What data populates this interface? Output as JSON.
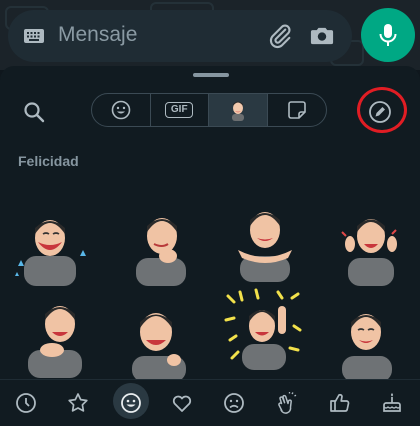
{
  "composer": {
    "placeholder": "Mensaje",
    "keyboard_icon": "keyboard-icon",
    "attach_icon": "paperclip-icon",
    "camera_icon": "camera-icon",
    "mic_icon": "microphone-icon",
    "accent": "#00a884"
  },
  "panel": {
    "search_icon": "search-icon",
    "tabs": [
      {
        "id": "emoji",
        "icon": "smiley-icon",
        "label": ""
      },
      {
        "id": "gif",
        "icon": "gif-icon",
        "label": "GIF"
      },
      {
        "id": "avatar",
        "icon": "avatar-icon",
        "label": "",
        "selected": true
      },
      {
        "id": "stickers",
        "icon": "sticker-icon",
        "label": ""
      }
    ],
    "edit_icon": "pencil-icon",
    "highlight_color": "#e11d24"
  },
  "section": {
    "title": "Felicidad"
  },
  "bottom_nav": {
    "items": [
      "clock-icon",
      "star-icon",
      "smiley-icon",
      "heart-icon",
      "sad-face-icon",
      "clapping-hands-icon",
      "thumbs-up-icon",
      "cake-icon"
    ],
    "selected_index": 2
  }
}
